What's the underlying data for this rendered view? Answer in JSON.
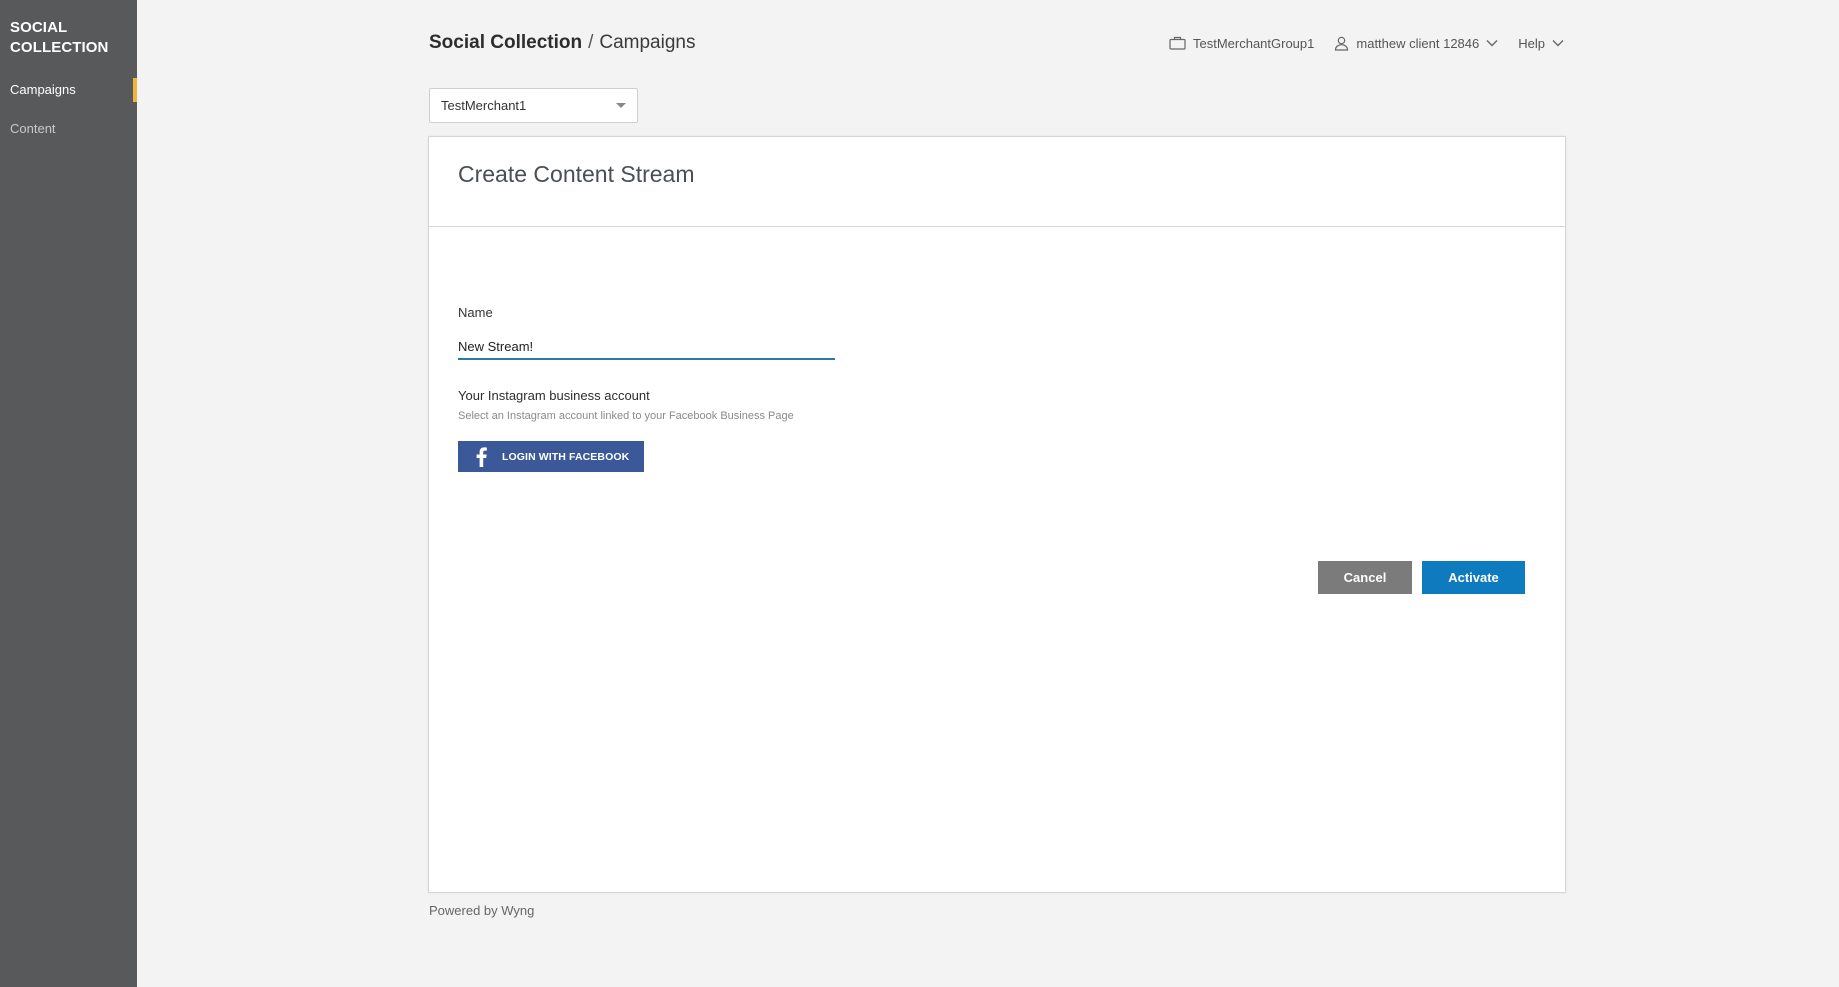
{
  "sidebar": {
    "brand_line1": "SOCIAL",
    "brand_line2": "COLLECTION",
    "items": [
      {
        "label": "Campaigns",
        "active": true
      },
      {
        "label": "Content",
        "active": false
      }
    ],
    "accent_color": "#f0b43c"
  },
  "header": {
    "title": "Social Collection",
    "separator": "/",
    "subtitle": "Campaigns"
  },
  "topbar": {
    "merchant_group": "TestMerchantGroup1",
    "merchant_group_icon": "briefcase-icon",
    "user": "matthew client 12846",
    "user_icon": "user-icon",
    "help": "Help"
  },
  "merchant_select": {
    "value": "TestMerchant1"
  },
  "form": {
    "title": "Create Content Stream",
    "name_label": "Name",
    "name_value": "New Stream!",
    "ig_label": "Your Instagram business account",
    "ig_sub": "Select an Instagram account linked to your Facebook Business Page",
    "fb_button": "Login with Facebook",
    "fb_color": "#3b5998",
    "cancel": "Cancel",
    "activate": "Activate",
    "activate_color": "#0f7bbf"
  },
  "footer": {
    "text": "Powered by Wyng"
  }
}
